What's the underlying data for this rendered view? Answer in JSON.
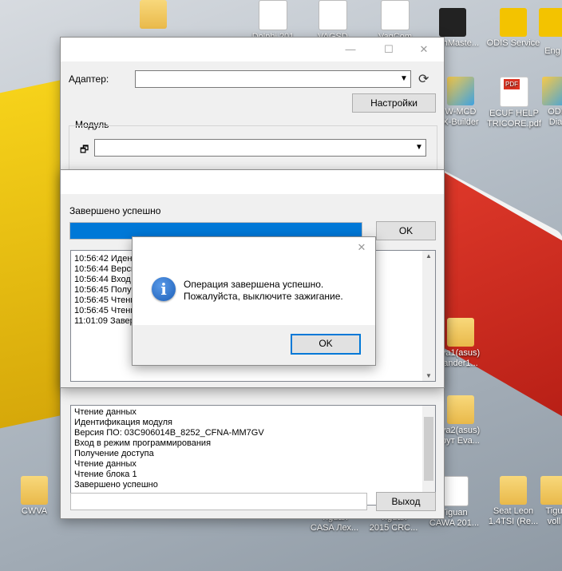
{
  "desktop": {
    "icons": [
      {
        "label": "",
        "x": "",
        "kind": "folder"
      },
      {
        "label": "Dolphi 201",
        "kind": "doc"
      },
      {
        "label": "VAGSD",
        "kind": "doc"
      },
      {
        "label": "VagCom",
        "kind": "doc"
      },
      {
        "label": "FlashMaste...",
        "kind": "dark"
      },
      {
        "label": "ODIS Service",
        "kind": "odis"
      },
      {
        "label": "Eng",
        "kind": "odis"
      },
      {
        "label": "W-MCD\nX-Builder",
        "kind": "box"
      },
      {
        "label": "ECUF HELP\nTRICORE.pdf",
        "kind": "pdf"
      },
      {
        "label": "ODI\nDia",
        "kind": "box"
      },
      {
        "label": "va1(asus)\nander1...",
        "kind": "folder"
      },
      {
        "label": "va2(asus)\nрут Eva...",
        "kind": "folder"
      },
      {
        "label": "CWVA",
        "kind": "folder"
      },
      {
        "label": "Tiguan\nCAWA 201...",
        "kind": "doc"
      },
      {
        "label": "Seat Leon\n1.4TSI (Re...",
        "kind": "folder"
      },
      {
        "label": "Tigu\nvoll",
        "kind": "folder"
      },
      {
        "label": "Tiguan\nCASA Лех...",
        "kind": "doc"
      },
      {
        "label": "Tiguan\n2015 CRC...",
        "kind": "doc"
      }
    ]
  },
  "main_window": {
    "title": "",
    "adapter_label": "Адаптер:",
    "adapter_value": "",
    "settings_label": "Настройки",
    "module_group": "Модуль",
    "module_value": "",
    "log_lines": [
      "Чтение данных",
      "Идентификация модуля",
      "Версия ПО: 03C906014B_8252_CFNA-MM7GV",
      "Вход в режим программирования",
      "Получение доступа",
      "Чтение данных",
      "Чтение блока 1",
      "Завершено успешно"
    ],
    "exit_label": "Выход"
  },
  "progress_window": {
    "title": "",
    "status": "Завершено успешно",
    "progress": 1.0,
    "ok_label": "OK",
    "log_lines": [
      "10:56:42 Иден",
      "10:56:44 Верси",
      "10:56:44 Вход",
      "10:56:45 Получ",
      "10:56:45 Чтени",
      "10:56:45 Чтени",
      "11:01:09 Завер"
    ]
  },
  "dialog": {
    "title": "",
    "message_line1": "Операция завершена успешно.",
    "message_line2": "Пожалуйста, выключите зажигание.",
    "ok_label": "OK",
    "icon": "info-icon"
  },
  "colors": {
    "progress_fill": "#0078d7",
    "info_icon": "#1c5fb8"
  }
}
